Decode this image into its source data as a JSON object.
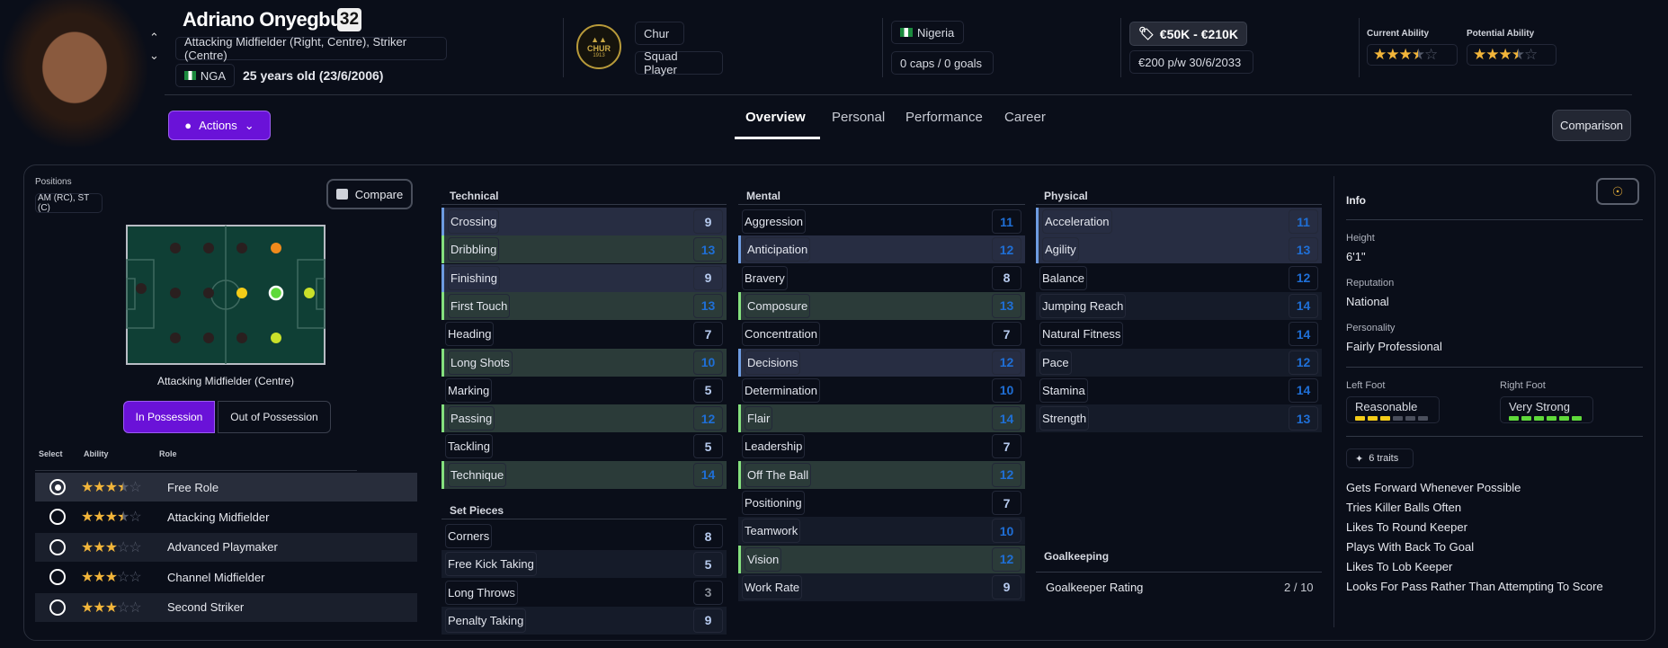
{
  "player": {
    "name": "Adriano Onyegbule",
    "number": "32",
    "positions_long": "Attacking Midfielder (Right, Centre), Striker (Centre)",
    "nation_code": "NGA",
    "age": "25 years old (23/6/2006)"
  },
  "club": {
    "name": "Chur",
    "badge_text": "CHUR",
    "badge_year": "1913",
    "status": "Squad Player"
  },
  "nation": {
    "name": "Nigeria",
    "caps": "0 caps / 0 goals"
  },
  "contract": {
    "value": "€50K - €210K",
    "wage": "€200 p/w 30/6/2033"
  },
  "ability": {
    "current_label": "Current Ability",
    "current_stars": 3.5,
    "potential_label": "Potential Ability",
    "potential_stars": 3.5
  },
  "colors": {
    "accent": "#6a12d8",
    "star": "#f2b53a",
    "value_high": "#1f6fd6",
    "highlight_blue": "#6d9be0",
    "highlight_green": "#84e07e"
  },
  "actions_label": "Actions",
  "tabs": [
    {
      "label": "Overview",
      "active": true
    },
    {
      "label": "Personal"
    },
    {
      "label": "Performance"
    },
    {
      "label": "Career"
    }
  ],
  "comparison_label": "Comparison",
  "left": {
    "positions_label": "Positions",
    "positions_value": "AM (RC), ST (C)",
    "compare_label": "Compare",
    "pitch_caption": "Attacking Midfielder (Centre)",
    "toggle": [
      "In Possession",
      "Out of Possession"
    ],
    "headers": [
      "Select",
      "Ability",
      "Role"
    ],
    "roles": [
      {
        "name": "Free Role",
        "stars": 3.5,
        "selected": true
      },
      {
        "name": "Attacking Midfielder",
        "stars": 3.5
      },
      {
        "name": "Advanced Playmaker",
        "stars": 3
      },
      {
        "name": "Channel Midfielder",
        "stars": 3
      },
      {
        "name": "Second Striker",
        "stars": 3
      }
    ]
  },
  "technical": {
    "title": "Technical",
    "rows": [
      {
        "n": "Crossing",
        "v": 9,
        "h": "blue"
      },
      {
        "n": "Dribbling",
        "v": 13,
        "h": "green"
      },
      {
        "n": "Finishing",
        "v": 9,
        "h": "blue"
      },
      {
        "n": "First Touch",
        "v": 13,
        "h": "green"
      },
      {
        "n": "Heading",
        "v": 7,
        "h": ""
      },
      {
        "n": "Long Shots",
        "v": 10,
        "h": "green"
      },
      {
        "n": "Marking",
        "v": 5,
        "h": ""
      },
      {
        "n": "Passing",
        "v": 12,
        "h": "green"
      },
      {
        "n": "Tackling",
        "v": 5,
        "h": ""
      },
      {
        "n": "Technique",
        "v": 14,
        "h": "green"
      }
    ]
  },
  "set_pieces": {
    "title": "Set Pieces",
    "rows": [
      {
        "n": "Corners",
        "v": 8,
        "h": ""
      },
      {
        "n": "Free Kick Taking",
        "v": 5,
        "h": "alt"
      },
      {
        "n": "Long Throws",
        "v": 3,
        "h": ""
      },
      {
        "n": "Penalty Taking",
        "v": 9,
        "h": "alt"
      }
    ]
  },
  "mental": {
    "title": "Mental",
    "rows": [
      {
        "n": "Aggression",
        "v": 11,
        "h": ""
      },
      {
        "n": "Anticipation",
        "v": 12,
        "h": "blue"
      },
      {
        "n": "Bravery",
        "v": 8,
        "h": ""
      },
      {
        "n": "Composure",
        "v": 13,
        "h": "green"
      },
      {
        "n": "Concentration",
        "v": 7,
        "h": ""
      },
      {
        "n": "Decisions",
        "v": 12,
        "h": "blue"
      },
      {
        "n": "Determination",
        "v": 10,
        "h": ""
      },
      {
        "n": "Flair",
        "v": 14,
        "h": "green"
      },
      {
        "n": "Leadership",
        "v": 7,
        "h": ""
      },
      {
        "n": "Off The Ball",
        "v": 12,
        "h": "green"
      },
      {
        "n": "Positioning",
        "v": 7,
        "h": ""
      },
      {
        "n": "Teamwork",
        "v": 10,
        "h": "alt"
      },
      {
        "n": "Vision",
        "v": 12,
        "h": "green"
      },
      {
        "n": "Work Rate",
        "v": 9,
        "h": "alt"
      }
    ]
  },
  "physical": {
    "title": "Physical",
    "rows": [
      {
        "n": "Acceleration",
        "v": 11,
        "h": "blue"
      },
      {
        "n": "Agility",
        "v": 13,
        "h": "blue"
      },
      {
        "n": "Balance",
        "v": 12,
        "h": ""
      },
      {
        "n": "Jumping Reach",
        "v": 14,
        "h": "alt"
      },
      {
        "n": "Natural Fitness",
        "v": 14,
        "h": ""
      },
      {
        "n": "Pace",
        "v": 12,
        "h": "alt"
      },
      {
        "n": "Stamina",
        "v": 14,
        "h": ""
      },
      {
        "n": "Strength",
        "v": 13,
        "h": "alt"
      }
    ]
  },
  "goalkeeping": {
    "title": "Goalkeeping",
    "label": "Goalkeeper Rating",
    "value": "2 / 10"
  },
  "info": {
    "title": "Info",
    "height_label": "Height",
    "height": "6'1\"",
    "reputation_label": "Reputation",
    "reputation": "National",
    "personality_label": "Personality",
    "personality": "Fairly Professional",
    "left_foot_label": "Left Foot",
    "left_foot": "Reasonable",
    "left_foot_level": 3,
    "right_foot_label": "Right Foot",
    "right_foot": "Very Strong",
    "right_foot_level": 6,
    "traits_count": "6 traits",
    "traits": [
      "Gets Forward Whenever Possible",
      "Tries Killer Balls Often",
      "Likes To Round Keeper",
      "Plays With Back To Goal",
      "Likes To Lob Keeper",
      "Looks For Pass Rather Than Attempting To Score"
    ]
  }
}
